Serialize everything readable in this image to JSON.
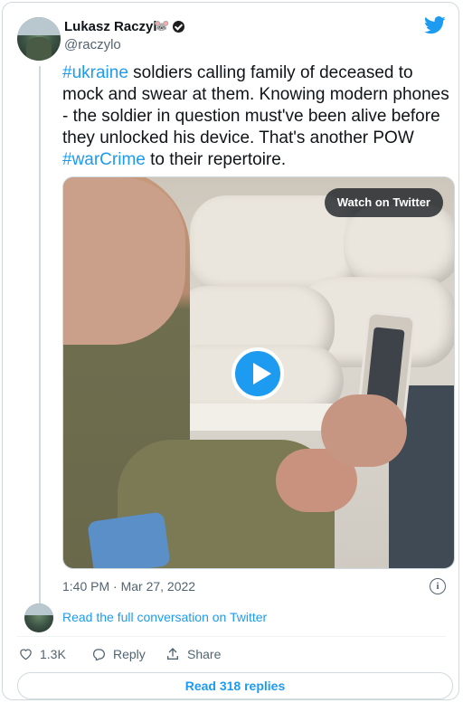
{
  "author": {
    "name": "Lukasz Raczylo",
    "emoji": "🐭",
    "handle": "@raczylo"
  },
  "tweet": {
    "segments": [
      {
        "text": "#ukraine",
        "type": "hashtag"
      },
      {
        "text": " soldiers calling family of deceased to mock and swear at them. Knowing modern phones - the soldier in question must've been alive before they unlocked his device. That's another POW ",
        "type": "text"
      },
      {
        "text": "#warCrime",
        "type": "hashtag"
      },
      {
        "text": " to their repertoire.",
        "type": "text"
      }
    ]
  },
  "media": {
    "watch_label": "Watch on Twitter"
  },
  "timestamp": "1:40 PM · Mar 27, 2022",
  "info_label": "i",
  "conversation_link": "Read the full conversation on Twitter",
  "actions": {
    "like_count": "1.3K",
    "reply_label": "Reply",
    "share_label": "Share"
  },
  "replies_button": "Read 318 replies",
  "colors": {
    "accent": "#1d9bf0",
    "text": "#0f1419",
    "muted": "#536471",
    "border": "#cfd9de"
  },
  "icons": [
    "twitter-bird-icon",
    "verified-icon",
    "play-icon",
    "info-icon",
    "heart-icon",
    "reply-icon",
    "share-icon"
  ]
}
